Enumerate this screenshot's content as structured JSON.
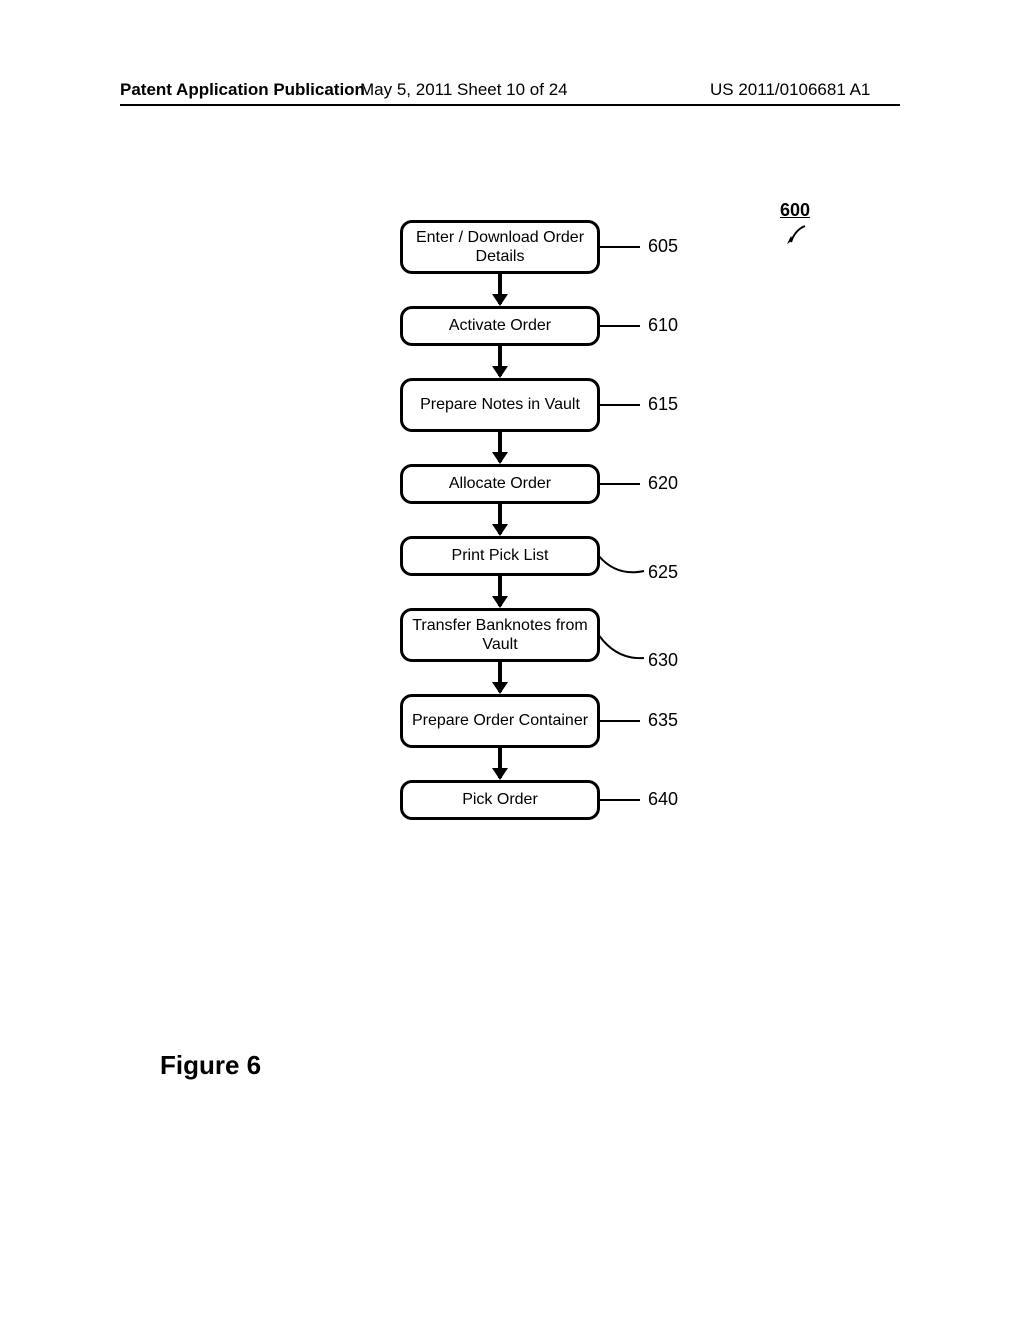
{
  "header": {
    "left": "Patent Application Publication",
    "mid": "May 5, 2011   Sheet 10 of 24",
    "right": "US 2011/0106681 A1"
  },
  "figure_ref": "600",
  "steps": [
    {
      "id": "605",
      "label": "Enter / Download Order Details"
    },
    {
      "id": "610",
      "label": "Activate Order"
    },
    {
      "id": "615",
      "label": "Prepare Notes in Vault"
    },
    {
      "id": "620",
      "label": "Allocate Order"
    },
    {
      "id": "625",
      "label": "Print Pick List"
    },
    {
      "id": "630",
      "label": "Transfer Banknotes from Vault"
    },
    {
      "id": "635",
      "label": "Prepare Order Container"
    },
    {
      "id": "640",
      "label": "Pick Order"
    }
  ],
  "caption": "Figure 6",
  "chart_data": {
    "type": "flowchart",
    "title": "Figure 6",
    "reference_numeral": "600",
    "nodes": [
      {
        "id": "605",
        "label": "Enter / Download Order Details"
      },
      {
        "id": "610",
        "label": "Activate Order"
      },
      {
        "id": "615",
        "label": "Prepare Notes in Vault"
      },
      {
        "id": "620",
        "label": "Allocate Order"
      },
      {
        "id": "625",
        "label": "Print Pick List"
      },
      {
        "id": "630",
        "label": "Transfer Banknotes from Vault"
      },
      {
        "id": "635",
        "label": "Prepare Order Container"
      },
      {
        "id": "640",
        "label": "Pick Order"
      }
    ],
    "edges": [
      [
        "605",
        "610"
      ],
      [
        "610",
        "615"
      ],
      [
        "615",
        "620"
      ],
      [
        "620",
        "625"
      ],
      [
        "625",
        "630"
      ],
      [
        "630",
        "635"
      ],
      [
        "635",
        "640"
      ]
    ]
  }
}
